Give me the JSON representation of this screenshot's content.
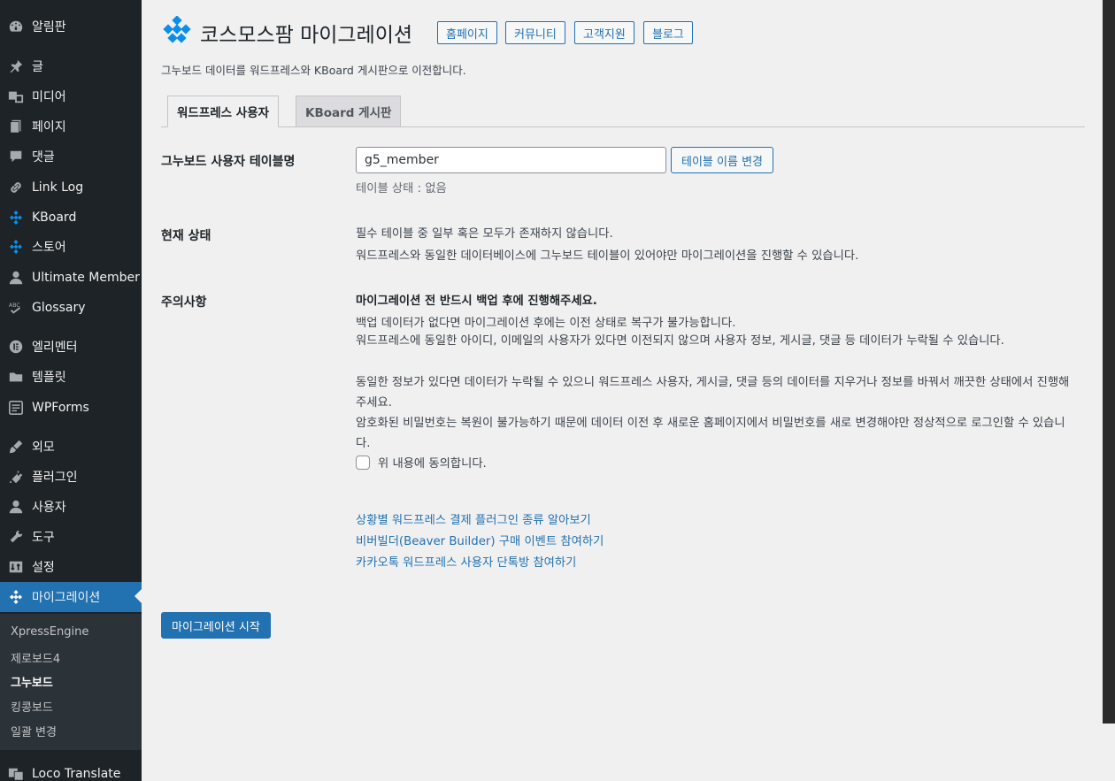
{
  "sidebar": {
    "items": [
      {
        "label": "알림판",
        "icon": "dashboard-icon"
      },
      {
        "label": "글",
        "icon": "pin-icon"
      },
      {
        "label": "미디어",
        "icon": "media-icon"
      },
      {
        "label": "페이지",
        "icon": "page-icon"
      },
      {
        "label": "댓글",
        "icon": "comment-icon"
      },
      {
        "label": "Link Log",
        "icon": "link-icon"
      },
      {
        "label": "KBoard",
        "icon": "kboard-icon"
      },
      {
        "label": "스토어",
        "icon": "store-icon"
      },
      {
        "label": "Ultimate Member",
        "icon": "user-icon"
      },
      {
        "label": "Glossary",
        "icon": "glossary-icon"
      },
      {
        "label": "엘리멘터",
        "icon": "elementor-icon"
      },
      {
        "label": "템플릿",
        "icon": "folder-icon"
      },
      {
        "label": "WPForms",
        "icon": "forms-icon"
      },
      {
        "label": "외모",
        "icon": "brush-icon"
      },
      {
        "label": "플러그인",
        "icon": "plugin-icon"
      },
      {
        "label": "사용자",
        "icon": "users-icon"
      },
      {
        "label": "도구",
        "icon": "wrench-icon"
      },
      {
        "label": "설정",
        "icon": "settings-icon"
      },
      {
        "label": "마이그레이션",
        "icon": "migration-icon"
      },
      {
        "label": "Loco Translate",
        "icon": "translate-icon"
      }
    ],
    "submenu": [
      {
        "label": "XpressEngine"
      },
      {
        "label": "제로보드4"
      },
      {
        "label": "그누보드"
      },
      {
        "label": "킹콩보드"
      },
      {
        "label": "일괄 변경"
      }
    ]
  },
  "header": {
    "title": "코스모스팜 마이그레이션",
    "buttons": [
      "홈페이지",
      "커뮤니티",
      "고객지원",
      "블로그"
    ],
    "description": "그누보드 데이터를 워드프레스와 KBoard 게시판으로 이전합니다."
  },
  "tabs": [
    {
      "label": "워드프레스 사용자"
    },
    {
      "label": "KBoard 게시판"
    }
  ],
  "form": {
    "table_label": "그누보드 사용자 테이블명",
    "table_value": "g5_member",
    "rename_button": "테이블 이름 변경",
    "table_status": "테이블 상태 : 없음",
    "status_label": "현재 상태",
    "status_lines": [
      "필수 테이블 중 일부 혹은 모두가 존재하지 않습니다.",
      "워드프레스와 동일한 데이터베이스에 그누보드 테이블이 있어야만 마이그레이션을 진행할 수 있습니다."
    ],
    "caution_label": "주의사항",
    "caution_heading": "마이그레이션 전 반드시 백업 후에 진행해주세요.",
    "caution_lines": [
      "백업 데이터가 없다면 마이그레이션 후에는 이전 상태로 복구가 불가능합니다.",
      "워드프레스에 동일한 아이디, 이메일의 사용자가 있다면 이전되지 않으며 사용자 정보, 게시글, 댓글 등 데이터가 누락될 수 있습니다.",
      "동일한 정보가 있다면 데이터가 누락될 수 있으니 워드프레스 사용자, 게시글, 댓글 등의 데이터를 지우거나 정보를 바꿔서 깨끗한 상태에서 진행해주세요.",
      "암호화된 비밀번호는 복원이 불가능하기 때문에 데이터 이전 후 새로운 홈페이지에서 비밀번호를 새로 변경해야만 정상적으로 로그인할 수 있습니다."
    ],
    "agree_label": "위 내용에 동의합니다.",
    "links": [
      "상황별 워드프레스 결제 플러그인 종류 알아보기",
      "비버빌더(Beaver Builder) 구매 이벤트 참여하기",
      "카카오톡 워드프레스 사용자 단톡방 참여하기"
    ],
    "start_button": "마이그레이션 시작"
  },
  "colors": {
    "sidebar_bg": "#1d2327",
    "accent": "#2271b1",
    "logo": "#0b8ee8"
  }
}
